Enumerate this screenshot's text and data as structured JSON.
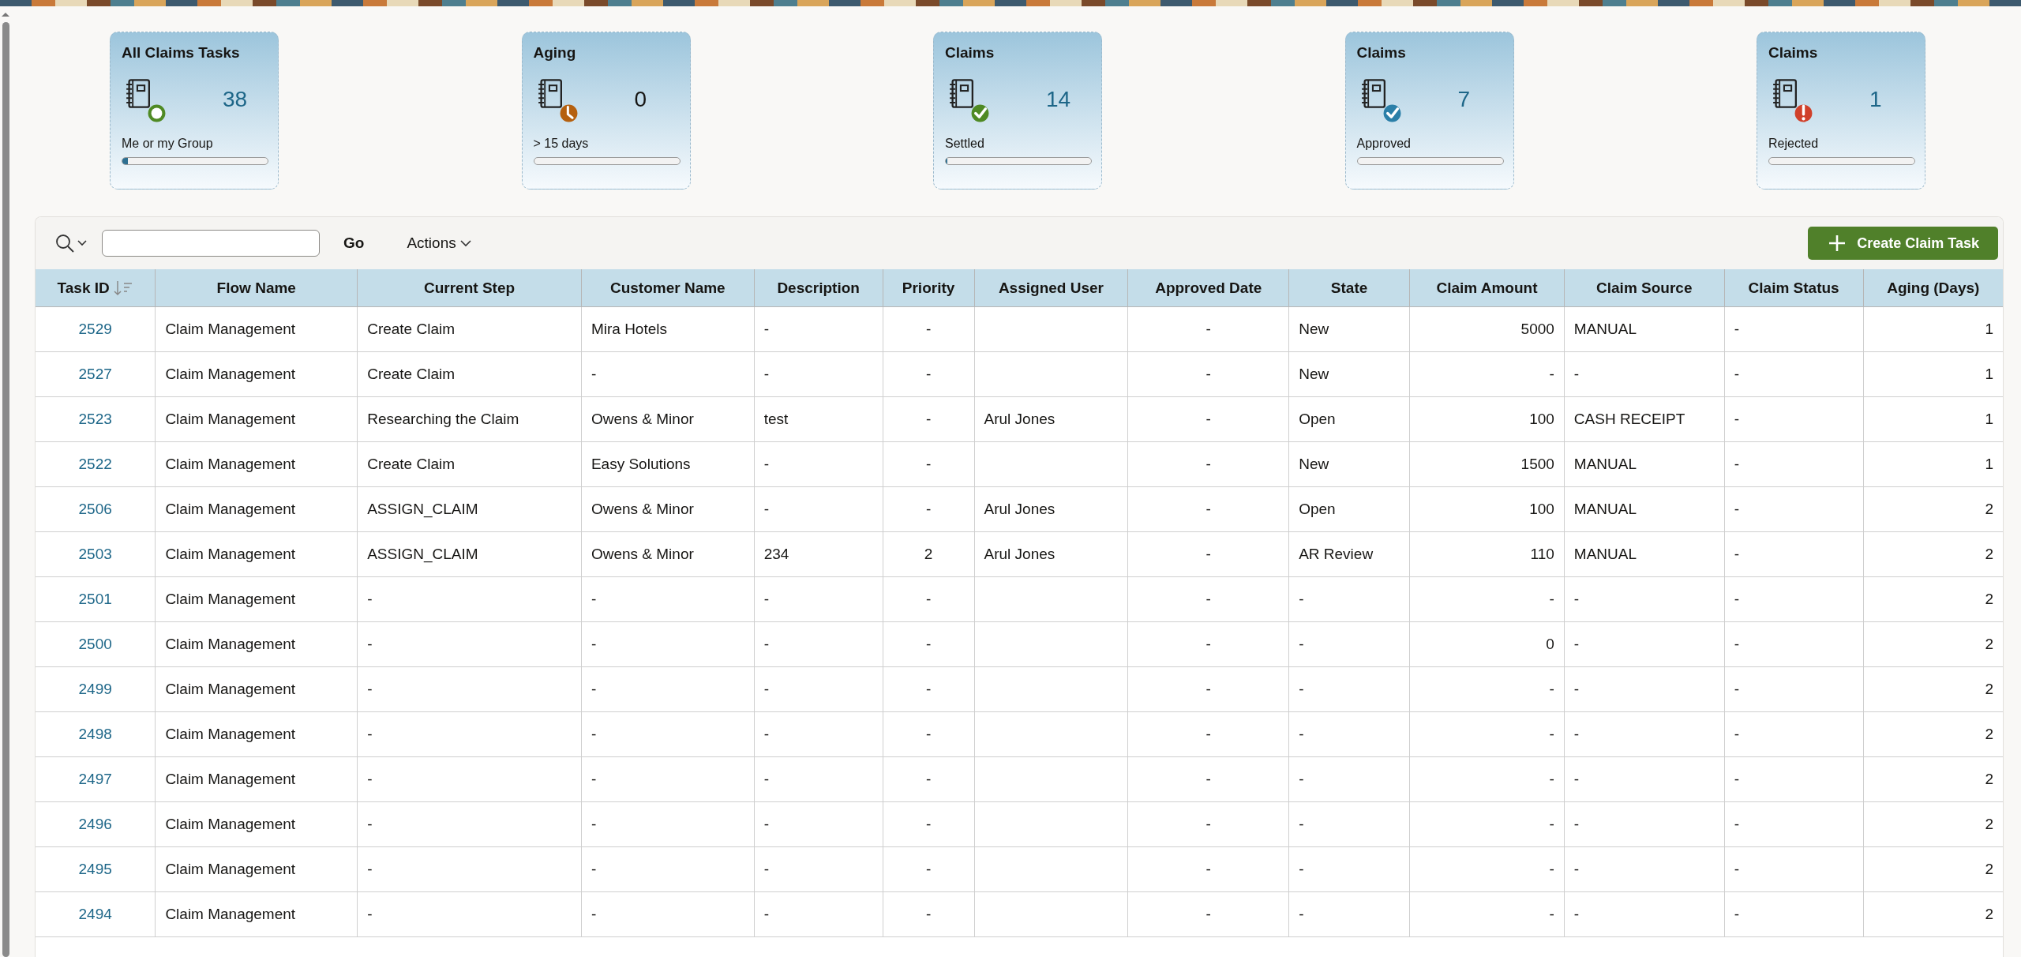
{
  "cards": [
    {
      "title": "All Claims Tasks",
      "value": "38",
      "caption": "Me or my Group",
      "accent": true,
      "level": 0.04,
      "badge": {
        "kind": "ring",
        "color": "#4f8a24"
      }
    },
    {
      "title": "Aging",
      "value": "0",
      "caption": "> 15 days",
      "accent": false,
      "level": 0,
      "badge": {
        "kind": "clock",
        "color": "#b5600f"
      }
    },
    {
      "title": "Claims",
      "value": "14",
      "caption": "Settled",
      "accent": true,
      "level": 0.01,
      "badge": {
        "kind": "check",
        "color": "#4f8a24"
      }
    },
    {
      "title": "Claims",
      "value": "7",
      "caption": "Approved",
      "accent": true,
      "level": 0,
      "badge": {
        "kind": "check",
        "color": "#2b7fa8"
      }
    },
    {
      "title": "Claims",
      "value": "1",
      "caption": "Rejected",
      "accent": true,
      "level": 0,
      "badge": {
        "kind": "alert",
        "color": "#d0402a"
      }
    }
  ],
  "toolbar": {
    "go": "Go",
    "actions": "Actions",
    "create": "Create Claim Task"
  },
  "table": {
    "columns": [
      {
        "label": "Task ID",
        "sorted": true
      },
      {
        "label": "Flow Name",
        "sorted": false
      },
      {
        "label": "Current Step",
        "sorted": false
      },
      {
        "label": "Customer Name",
        "sorted": false
      },
      {
        "label": "Description",
        "sorted": false
      },
      {
        "label": "Priority",
        "sorted": false
      },
      {
        "label": "Assigned User",
        "sorted": false
      },
      {
        "label": "Approved Date",
        "sorted": false
      },
      {
        "label": "State",
        "sorted": false
      },
      {
        "label": "Claim Amount",
        "sorted": false
      },
      {
        "label": "Claim Source",
        "sorted": false
      },
      {
        "label": "Claim Status",
        "sorted": false
      },
      {
        "label": "Aging (Days)",
        "sorted": false
      }
    ],
    "rows": [
      [
        "2529",
        "Claim Management",
        "Create Claim",
        "Mira Hotels",
        "-",
        "-",
        "",
        "-",
        "New",
        "5000",
        "MANUAL",
        "-",
        "1"
      ],
      [
        "2527",
        "Claim Management",
        "Create Claim",
        "-",
        "-",
        "-",
        "",
        "-",
        "New",
        "-",
        "-",
        "-",
        "1"
      ],
      [
        "2523",
        "Claim Management",
        "Researching the Claim",
        "Owens & Minor",
        "test",
        "-",
        "Arul Jones",
        "-",
        "Open",
        "100",
        "CASH RECEIPT",
        "-",
        "1"
      ],
      [
        "2522",
        "Claim Management",
        "Create Claim",
        "Easy Solutions",
        "-",
        "-",
        "",
        "-",
        "New",
        "1500",
        "MANUAL",
        "-",
        "1"
      ],
      [
        "2506",
        "Claim Management",
        "ASSIGN_CLAIM",
        "Owens & Minor",
        "-",
        "-",
        "Arul Jones",
        "-",
        "Open",
        "100",
        "MANUAL",
        "-",
        "2"
      ],
      [
        "2503",
        "Claim Management",
        "ASSIGN_CLAIM",
        "Owens & Minor",
        "234",
        "2",
        "Arul Jones",
        "-",
        "AR Review",
        "110",
        "MANUAL",
        "-",
        "2"
      ],
      [
        "2501",
        "Claim Management",
        "-",
        "-",
        "-",
        "-",
        "",
        "-",
        "-",
        "-",
        "-",
        "-",
        "2"
      ],
      [
        "2500",
        "Claim Management",
        "-",
        "-",
        "-",
        "-",
        "",
        "-",
        "-",
        "0",
        "-",
        "-",
        "2"
      ],
      [
        "2499",
        "Claim Management",
        "-",
        "-",
        "-",
        "-",
        "",
        "-",
        "-",
        "-",
        "-",
        "-",
        "2"
      ],
      [
        "2498",
        "Claim Management",
        "-",
        "-",
        "-",
        "-",
        "",
        "-",
        "-",
        "-",
        "-",
        "-",
        "2"
      ],
      [
        "2497",
        "Claim Management",
        "-",
        "-",
        "-",
        "-",
        "",
        "-",
        "-",
        "-",
        "-",
        "-",
        "2"
      ],
      [
        "2496",
        "Claim Management",
        "-",
        "-",
        "-",
        "-",
        "",
        "-",
        "-",
        "-",
        "-",
        "-",
        "2"
      ],
      [
        "2495",
        "Claim Management",
        "-",
        "-",
        "-",
        "-",
        "",
        "-",
        "-",
        "-",
        "-",
        "-",
        "2"
      ],
      [
        "2494",
        "Claim Management",
        "-",
        "-",
        "-",
        "-",
        "",
        "-",
        "-",
        "-",
        "-",
        "-",
        "2"
      ]
    ]
  }
}
